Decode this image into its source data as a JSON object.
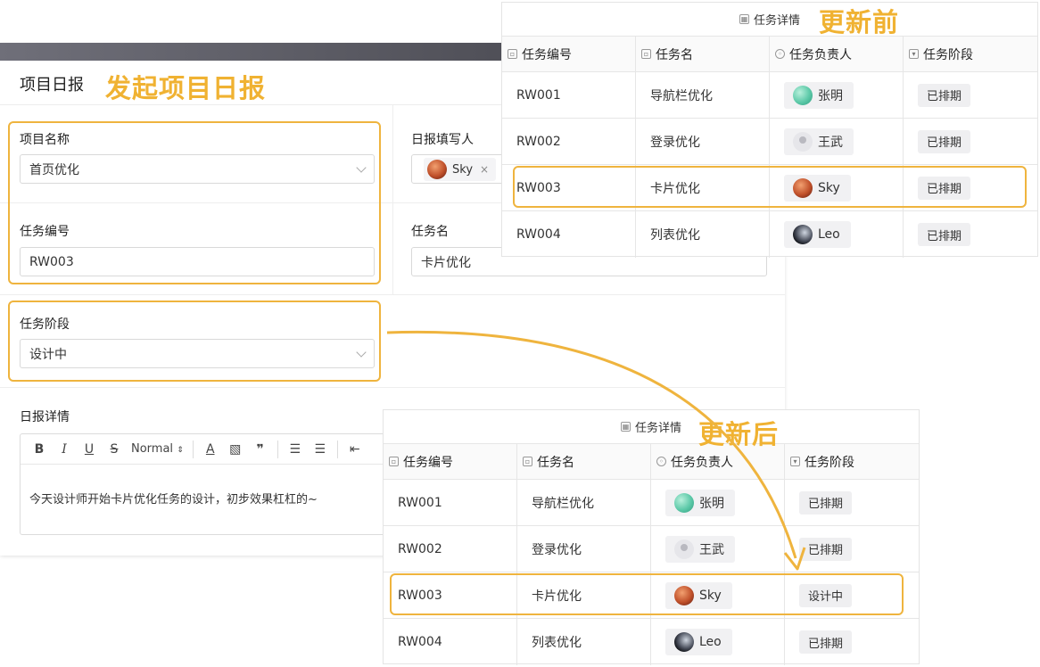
{
  "form": {
    "title": "项目日报",
    "callout": "发起项目日报",
    "project_name": {
      "label": "项目名称",
      "value": "首页优化"
    },
    "reporter": {
      "label": "日报填写人",
      "user": "Sky"
    },
    "task_id": {
      "label": "任务编号",
      "value": "RW003"
    },
    "task_name": {
      "label": "任务名",
      "value": "卡片优化"
    },
    "task_stage": {
      "label": "任务阶段",
      "value": "设计中"
    },
    "details": {
      "label": "日报详情",
      "toolbar": {
        "bold": "B",
        "italic": "I",
        "underline": "U",
        "strike": "S",
        "format": "Normal"
      },
      "content": "今天设计师开始卡片优化任务的设计，初步效果杠杠的~"
    }
  },
  "table_before": {
    "title": "任务详情",
    "callout": "更新前",
    "columns": [
      "任务编号",
      "任务名",
      "任务负责人",
      "任务阶段"
    ],
    "rows": [
      {
        "id": "RW001",
        "name": "导航栏优化",
        "owner": "张明",
        "stage": "已排期"
      },
      {
        "id": "RW002",
        "name": "登录优化",
        "owner": "王武",
        "stage": "已排期"
      },
      {
        "id": "RW003",
        "name": "卡片优化",
        "owner": "Sky",
        "stage": "已排期"
      },
      {
        "id": "RW004",
        "name": "列表优化",
        "owner": "Leo",
        "stage": "已排期"
      }
    ]
  },
  "table_after": {
    "title": "任务详情",
    "callout": "更新后",
    "columns": [
      "任务编号",
      "任务名",
      "任务负责人",
      "任务阶段"
    ],
    "rows": [
      {
        "id": "RW001",
        "name": "导航栏优化",
        "owner": "张明",
        "stage": "已排期"
      },
      {
        "id": "RW002",
        "name": "登录优化",
        "owner": "王武",
        "stage": "已排期"
      },
      {
        "id": "RW003",
        "name": "卡片优化",
        "owner": "Sky",
        "stage": "设计中"
      },
      {
        "id": "RW004",
        "name": "列表优化",
        "owner": "Leo",
        "stage": "已排期"
      }
    ]
  },
  "colors": {
    "highlight": "#efb43e",
    "callout": "#f0b232"
  }
}
